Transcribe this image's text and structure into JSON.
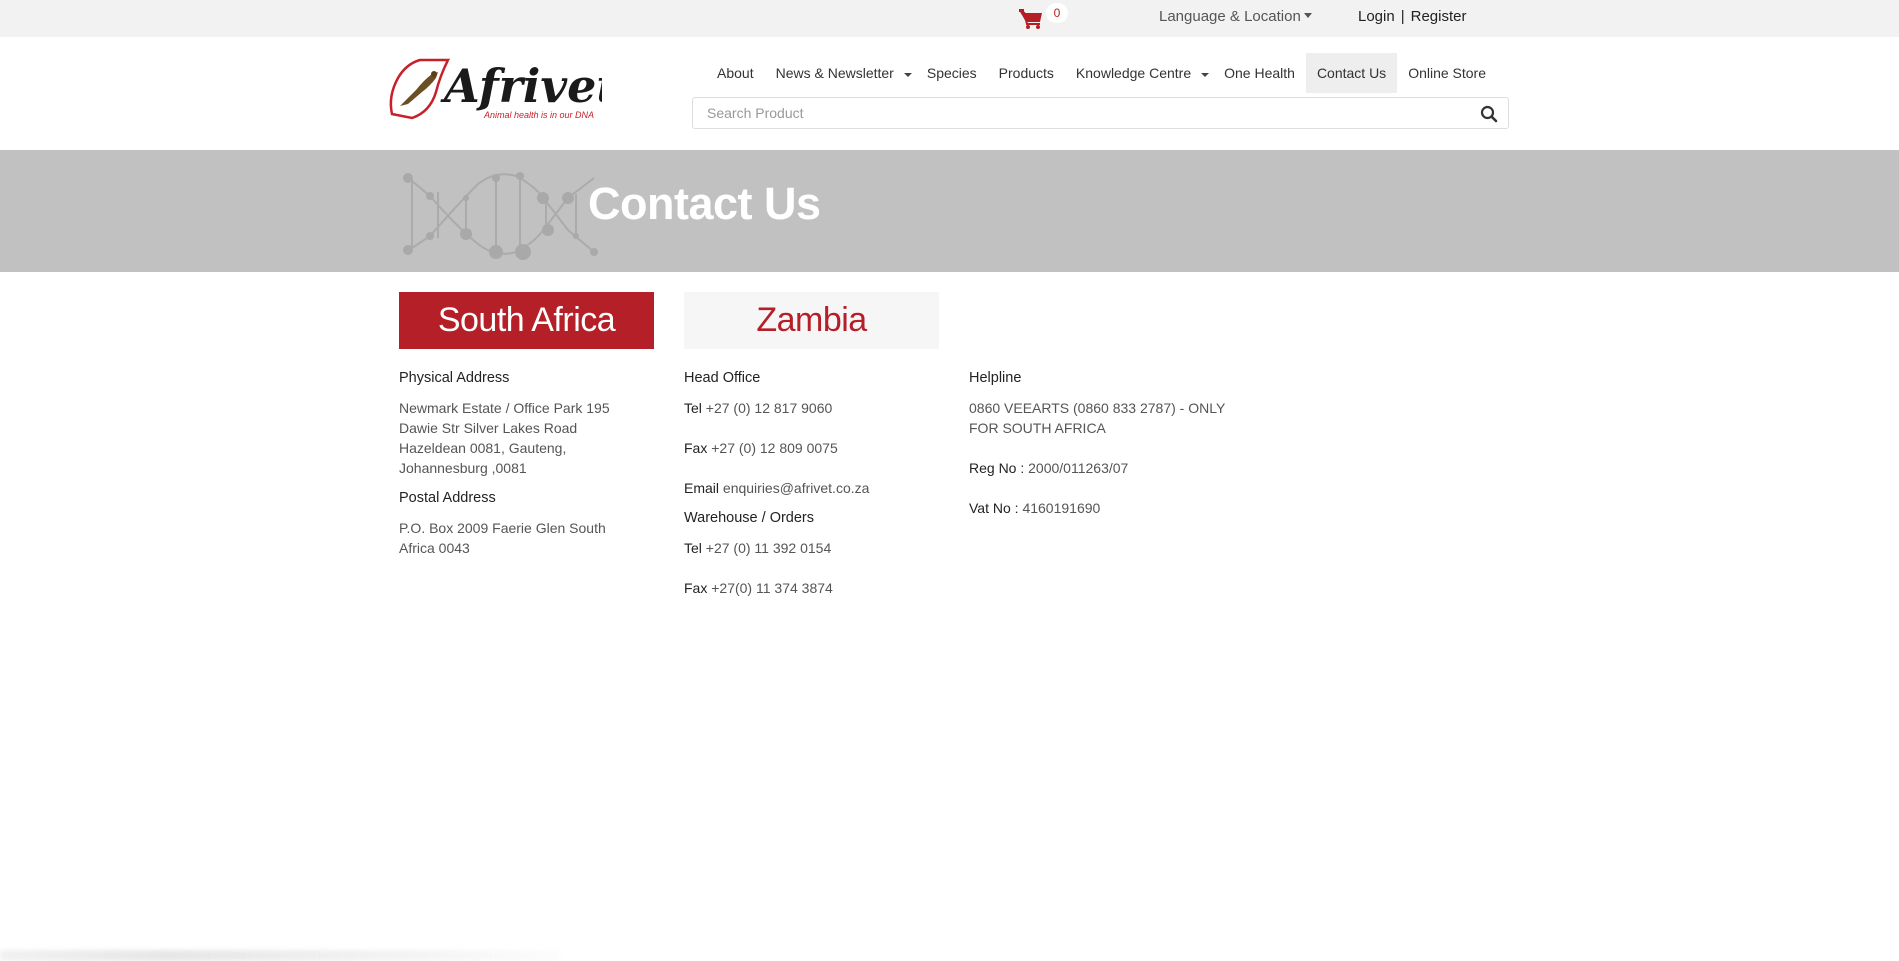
{
  "topbar": {
    "cart_count": "0",
    "language_label": "Language & Location",
    "login_label": "Login",
    "separator": "|",
    "register_label": "Register"
  },
  "header": {
    "logo_text": "Afrivet",
    "logo_tagline": "Animal health is in our DNA",
    "nav": [
      {
        "label": "About",
        "dropdown": false
      },
      {
        "label": "News & Newsletter",
        "dropdown": true
      },
      {
        "label": "Species",
        "dropdown": false
      },
      {
        "label": "Products",
        "dropdown": false
      },
      {
        "label": "Knowledge Centre",
        "dropdown": true
      },
      {
        "label": "One Health",
        "dropdown": false
      },
      {
        "label": "Contact Us",
        "dropdown": false,
        "active": true
      },
      {
        "label": "Online Store",
        "dropdown": false
      }
    ],
    "search_placeholder": "Search Product",
    "search_value": ""
  },
  "banner": {
    "title": "Contact Us"
  },
  "tabs": [
    {
      "label": "South Africa",
      "active": true
    },
    {
      "label": "Zambia",
      "active": false
    }
  ],
  "contact": {
    "physical_heading": "Physical Address",
    "physical_lines": [
      "Newmark Estate / Office Park 195",
      "Dawie Str Silver Lakes Road",
      "Hazeldean 0081, Gauteng,",
      "Johannesburg ,0081"
    ],
    "postal_heading": "Postal Address",
    "postal_lines": [
      "P.O. Box 2009 Faerie Glen South",
      "Africa 0043"
    ],
    "head_office_heading": "Head Office",
    "head_office": {
      "tel_label": "Tel",
      "tel": "+27 (0) 12 817 9060",
      "fax_label": "Fax",
      "fax": "+27 (0) 12 809 0075",
      "email_label": "Email",
      "email": "enquiries@afrivet.co.za"
    },
    "warehouse_heading": "Warehouse / Orders",
    "warehouse": {
      "tel_label": "Tel",
      "tel": "+27 (0) 11 392 0154",
      "fax_label": "Fax",
      "fax": "+27(0) 11 374 3874"
    },
    "helpline_heading": "Helpline",
    "helpline_lines": [
      "0860 VEEARTS (0860 833 2787) - ONLY",
      "FOR SOUTH AFRICA"
    ],
    "reg_label": "Reg No :",
    "reg_value": "2000/011263/07",
    "vat_label": "Vat No :",
    "vat_value": "4160191690"
  },
  "colors": {
    "brand_red": "#b51f28",
    "banner_gray": "#c1c1c1",
    "topbar_bg": "#f2f2f2"
  }
}
